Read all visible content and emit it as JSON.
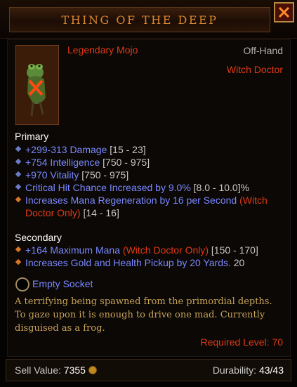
{
  "item": {
    "name": "THING OF THE DEEP",
    "type": "Legendary Mojo",
    "slot": "Off-Hand",
    "class_requirement": "Witch Doctor"
  },
  "primary": {
    "label": "Primary",
    "stats": [
      {
        "text": "+299-313 Damage",
        "suffix": "",
        "range": "[15 - 23]",
        "bullet": "blue"
      },
      {
        "text": "+754 Intelligence",
        "suffix": "",
        "range": "[750 - 975]",
        "bullet": "blue"
      },
      {
        "text": "+970 Vitality",
        "suffix": "",
        "range": "[750 - 975]",
        "bullet": "blue"
      },
      {
        "text": "Critical Hit Chance Increased by 9.0%",
        "suffix": "",
        "range": "[8.0 - 10.0]%",
        "bullet": "blue"
      },
      {
        "text": "Increases Mana Regeneration by 16 per Second",
        "suffix": "(Witch Doctor Only)",
        "range": "[14 - 16]",
        "bullet": "orange"
      }
    ]
  },
  "secondary": {
    "label": "Secondary",
    "stats": [
      {
        "text": "+164 Maximum Mana",
        "suffix": "(Witch Doctor Only)",
        "range": "[150 - 170]",
        "bullet": "orange"
      },
      {
        "text": "Increases Gold and Health Pickup by 20 Yards.",
        "suffix": "",
        "range": "20",
        "bullet": "orange"
      }
    ]
  },
  "socket": {
    "label": "Empty Socket"
  },
  "flavor_text": "A terrifying being spawned from the primordial depths. To gaze upon it is enough to drive one mad. Currently disguised as a frog.",
  "required_level": "Required Level: 70",
  "footer": {
    "sell_label": "Sell Value:",
    "sell_value": "7355",
    "durability_label": "Durability:",
    "durability_value": "43/43"
  },
  "icons": {
    "close": "close-x-icon",
    "gold": "gold-coin-icon",
    "socket": "socket-ring-icon",
    "item": "frog-mojo-icon"
  },
  "colors": {
    "legendary": "#e03a16",
    "magic_stat": "#7a88ff",
    "title": "#d9862f",
    "flavor": "#c8a35a"
  }
}
